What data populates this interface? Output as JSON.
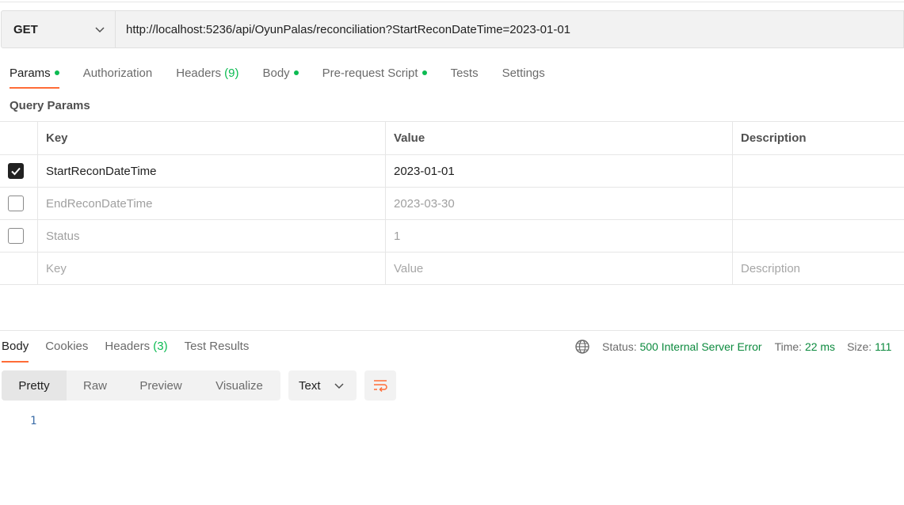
{
  "request": {
    "method": "GET",
    "url": "http://localhost:5236/api/OyunPalas/reconciliation?StartReconDateTime=2023-01-01"
  },
  "request_tabs": [
    {
      "label": "Params",
      "dot": true,
      "active": true
    },
    {
      "label": "Authorization"
    },
    {
      "label": "Headers",
      "count": "(9)"
    },
    {
      "label": "Body",
      "dot": true
    },
    {
      "label": "Pre-request Script",
      "dot": true
    },
    {
      "label": "Tests"
    },
    {
      "label": "Settings"
    }
  ],
  "query_params": {
    "title": "Query Params",
    "headers": {
      "key": "Key",
      "value": "Value",
      "description": "Description"
    },
    "rows": [
      {
        "checked": true,
        "key": "StartReconDateTime",
        "value": "2023-01-01",
        "description": ""
      },
      {
        "checked": false,
        "key": "EndReconDateTime",
        "value": "2023-03-30",
        "description": ""
      },
      {
        "checked": false,
        "key": "Status",
        "value": "1",
        "description": ""
      }
    ],
    "placeholder": {
      "key": "Key",
      "value": "Value",
      "description": "Description"
    }
  },
  "response": {
    "tabs": [
      {
        "label": "Body",
        "active": true
      },
      {
        "label": "Cookies"
      },
      {
        "label": "Headers",
        "count": "(3)"
      },
      {
        "label": "Test Results"
      }
    ],
    "status_label": "Status:",
    "status_value": "500 Internal Server Error",
    "time_label": "Time:",
    "time_value": "22 ms",
    "size_label": "Size:",
    "size_value": "111",
    "view_modes": [
      "Pretty",
      "Raw",
      "Preview",
      "Visualize"
    ],
    "format": "Text",
    "line_number": "1"
  },
  "colors": {
    "accent": "#ff6c37",
    "indicator": "#0cbb52",
    "status_ok_text": "#0c8a3e"
  }
}
